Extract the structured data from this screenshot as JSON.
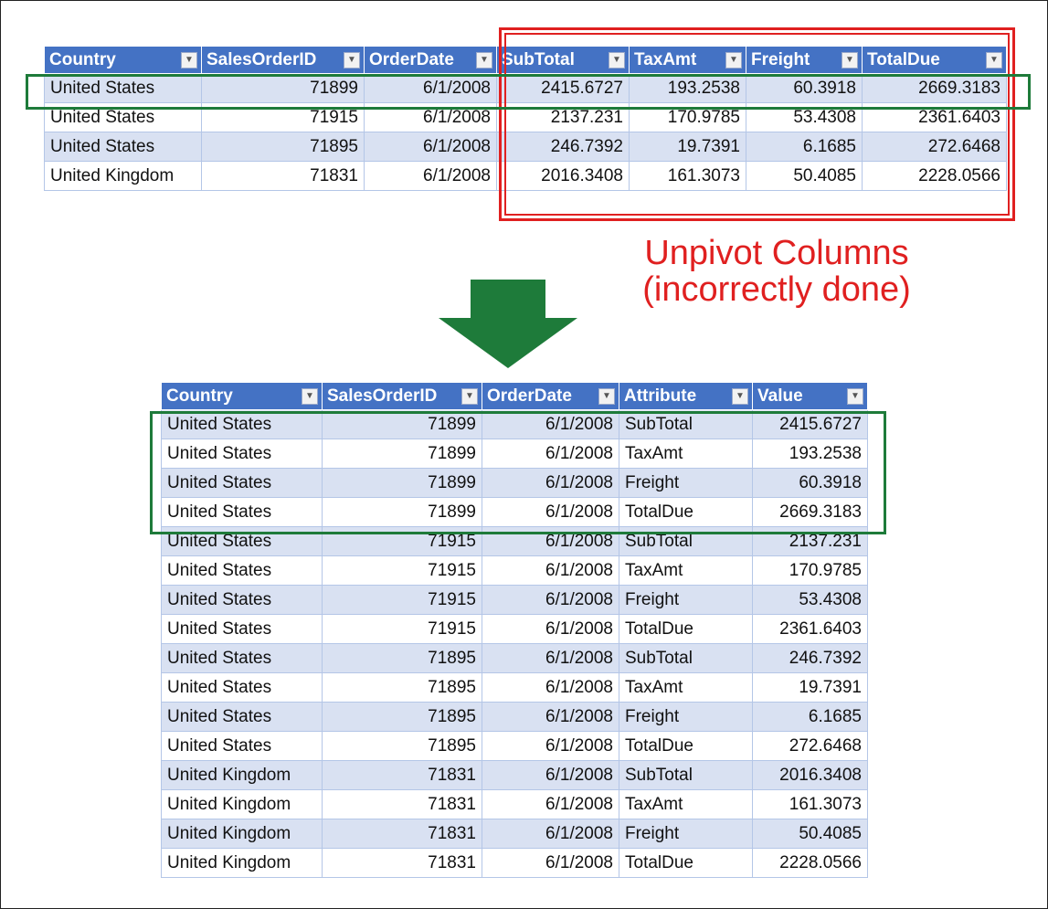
{
  "top_table": {
    "headers": [
      "Country",
      "SalesOrderID",
      "OrderDate",
      "SubTotal",
      "TaxAmt",
      "Freight",
      "TotalDue"
    ],
    "rows": [
      [
        "United States",
        "71899",
        "6/1/2008",
        "2415.6727",
        "193.2538",
        "60.3918",
        "2669.3183"
      ],
      [
        "United States",
        "71915",
        "6/1/2008",
        "2137.231",
        "170.9785",
        "53.4308",
        "2361.6403"
      ],
      [
        "United States",
        "71895",
        "6/1/2008",
        "246.7392",
        "19.7391",
        "6.1685",
        "272.6468"
      ],
      [
        "United Kingdom",
        "71831",
        "6/1/2008",
        "2016.3408",
        "161.3073",
        "50.4085",
        "2228.0566"
      ]
    ]
  },
  "caption": {
    "line1": "Unpivot Columns",
    "line2": "(incorrectly done)"
  },
  "bottom_table": {
    "headers": [
      "Country",
      "SalesOrderID",
      "OrderDate",
      "Attribute",
      "Value"
    ],
    "rows": [
      [
        "United States",
        "71899",
        "6/1/2008",
        "SubTotal",
        "2415.6727"
      ],
      [
        "United States",
        "71899",
        "6/1/2008",
        "TaxAmt",
        "193.2538"
      ],
      [
        "United States",
        "71899",
        "6/1/2008",
        "Freight",
        "60.3918"
      ],
      [
        "United States",
        "71899",
        "6/1/2008",
        "TotalDue",
        "2669.3183"
      ],
      [
        "United States",
        "71915",
        "6/1/2008",
        "SubTotal",
        "2137.231"
      ],
      [
        "United States",
        "71915",
        "6/1/2008",
        "TaxAmt",
        "170.9785"
      ],
      [
        "United States",
        "71915",
        "6/1/2008",
        "Freight",
        "53.4308"
      ],
      [
        "United States",
        "71915",
        "6/1/2008",
        "TotalDue",
        "2361.6403"
      ],
      [
        "United States",
        "71895",
        "6/1/2008",
        "SubTotal",
        "246.7392"
      ],
      [
        "United States",
        "71895",
        "6/1/2008",
        "TaxAmt",
        "19.7391"
      ],
      [
        "United States",
        "71895",
        "6/1/2008",
        "Freight",
        "6.1685"
      ],
      [
        "United States",
        "71895",
        "6/1/2008",
        "TotalDue",
        "272.6468"
      ],
      [
        "United Kingdom",
        "71831",
        "6/1/2008",
        "SubTotal",
        "2016.3408"
      ],
      [
        "United Kingdom",
        "71831",
        "6/1/2008",
        "TaxAmt",
        "161.3073"
      ],
      [
        "United Kingdom",
        "71831",
        "6/1/2008",
        "Freight",
        "50.4085"
      ],
      [
        "United Kingdom",
        "71831",
        "6/1/2008",
        "TotalDue",
        "2228.0566"
      ]
    ]
  },
  "colors": {
    "header_blue": "#4472C4",
    "band_blue": "#D9E1F2",
    "highlight_red": "#E02020",
    "highlight_green": "#1E7B3A",
    "arrow_green": "#1E7B3A"
  },
  "icons": [
    "filter-dropdown-icon",
    "down-arrow-icon"
  ]
}
